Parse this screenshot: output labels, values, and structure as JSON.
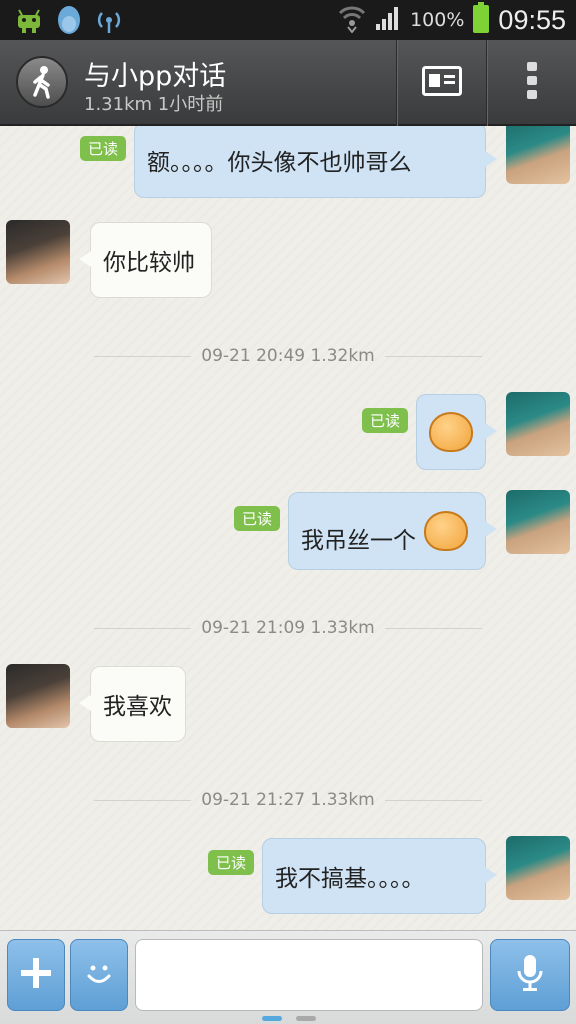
{
  "status_bar": {
    "battery_percent": "100%",
    "time": "09:55",
    "icons": [
      "android-debug-icon",
      "qq-penguin-icon",
      "usb-tether-icon",
      "wifi-icon",
      "signal-icon",
      "battery-icon"
    ]
  },
  "header": {
    "title": "与小pp对话",
    "subtitle": "1.31km 1小时前",
    "icons": [
      "walking-person-icon",
      "profile-card-icon",
      "more-vert-icon"
    ]
  },
  "messages": [
    {
      "from": "me",
      "text": "额。。。。你头像不也帅哥么",
      "read_label": "已读"
    },
    {
      "from": "other",
      "text": "你比较帅"
    },
    {
      "type": "divider",
      "text": "09-21 20:49    1.32km"
    },
    {
      "from": "me",
      "emoji": "smirk-emoji",
      "read_label": "已读"
    },
    {
      "from": "me",
      "text": "我吊丝一个",
      "emoji": "shy-emoji",
      "read_label": "已读"
    },
    {
      "type": "divider",
      "text": "09-21 21:09    1.33km"
    },
    {
      "from": "other",
      "text": "我喜欢"
    },
    {
      "type": "divider",
      "text": "09-21 21:27    1.33km"
    },
    {
      "from": "me",
      "text": "我不搞基。。。。",
      "read_label": "已读"
    }
  ],
  "composer": {
    "input_value": "",
    "placeholder": "",
    "icons": [
      "plus-icon",
      "smiley-icon",
      "microphone-icon"
    ]
  },
  "pager": {
    "pages": 2,
    "active": 1
  },
  "colors": {
    "my_bubble": "#cfe3f4",
    "other_bubble": "#fbfbf8",
    "read_badge": "#7fc04c",
    "accent_blue": "#5e9fd5"
  }
}
